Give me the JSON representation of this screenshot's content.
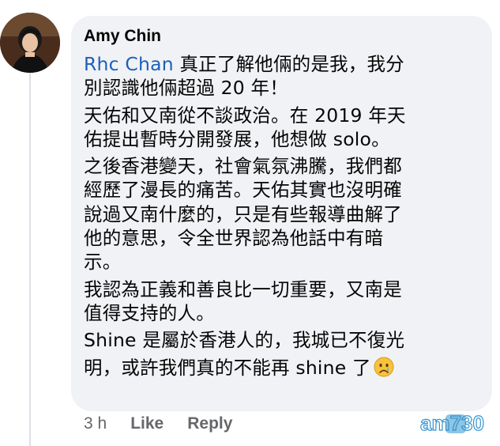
{
  "comment": {
    "author": "Amy Chin",
    "mention": "Rhc Chan",
    "lines": [
      " 真正了解他倆的是我，我分",
      "別認識他倆超過 20 年！",
      "天佑和又南從不談政治。在 2019 年天",
      "佑提出暫時分開發展，他想做 solo。",
      "之後香港變天，社會氣氛沸騰，我們都",
      "經歷了漫長的痛苦。天佑其實也沒明確",
      "說過又南什麼的，只是有些報導曲解了",
      "他的意思，令全世界認為他話中有暗",
      "示。",
      "我認為正義和善良比一切重要，又南是",
      "值得支持的人。",
      "Shine 是屬於香港人的，我城已不復光",
      "明，或許我們真的不能再 shine 了"
    ],
    "emoji": "crying-face-icon"
  },
  "actions": {
    "time": "3 h",
    "like": "Like",
    "reply": "Reply"
  },
  "watermark": {
    "text": "am730"
  },
  "colors": {
    "bubble": "#f0f2f5",
    "mention": "#1d5fb8",
    "action_text": "#65676b",
    "text": "#050505"
  }
}
